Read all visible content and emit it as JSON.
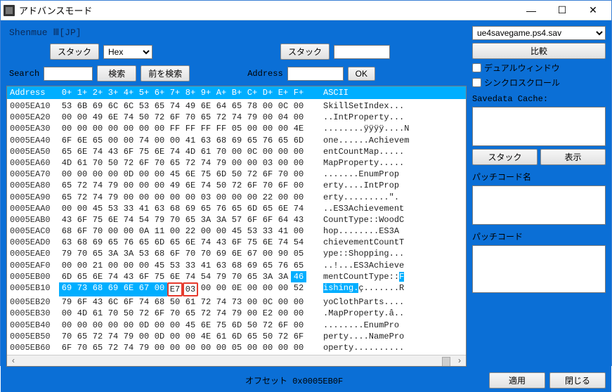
{
  "window": {
    "title": "アドバンスモード"
  },
  "winbtns": {
    "min": "—",
    "max": "☐",
    "close": "✕"
  },
  "file_title": "Shenmue Ⅲ[JP]",
  "toolbar1": {
    "stack": "スタック",
    "hex": "Hex",
    "search_label": "Search",
    "search_btn": "検索",
    "search_prev": "前を検索",
    "address_label": "Address",
    "stack2": "スタック",
    "ok": "OK"
  },
  "hexheader": {
    "address": "Address",
    "cols": [
      "0+",
      "1+",
      "2+",
      "3+",
      "4+",
      "5+",
      "6+",
      "7+",
      "8+",
      "9+",
      "A+",
      "B+",
      "C+",
      "D+",
      "E+",
      "F+"
    ],
    "ascii": "ASCII"
  },
  "rows": [
    {
      "addr": "0005EA10",
      "bytes": [
        "53",
        "6B",
        "69",
        "6C",
        "6C",
        "53",
        "65",
        "74",
        "49",
        "6E",
        "64",
        "65",
        "78",
        "00",
        "0C",
        "00"
      ],
      "ascii": "SkillSetIndex..."
    },
    {
      "addr": "0005EA20",
      "bytes": [
        "00",
        "00",
        "49",
        "6E",
        "74",
        "50",
        "72",
        "6F",
        "70",
        "65",
        "72",
        "74",
        "79",
        "00",
        "04",
        "00"
      ],
      "ascii": "..IntProperty..."
    },
    {
      "addr": "0005EA30",
      "bytes": [
        "00",
        "00",
        "00",
        "00",
        "00",
        "00",
        "00",
        "FF",
        "FF",
        "FF",
        "FF",
        "05",
        "00",
        "00",
        "00",
        "4E"
      ],
      "ascii": "........ÿÿÿÿ....N"
    },
    {
      "addr": "0005EA40",
      "bytes": [
        "6F",
        "6E",
        "65",
        "00",
        "00",
        "74",
        "00",
        "00",
        "41",
        "63",
        "68",
        "69",
        "65",
        "76",
        "65",
        "6D"
      ],
      "ascii": "one......Achievem"
    },
    {
      "addr": "0005EA50",
      "bytes": [
        "65",
        "6E",
        "74",
        "43",
        "6F",
        "75",
        "6E",
        "74",
        "4D",
        "61",
        "70",
        "00",
        "0C",
        "00",
        "00",
        "00"
      ],
      "ascii": "entCountMap....."
    },
    {
      "addr": "0005EA60",
      "bytes": [
        "4D",
        "61",
        "70",
        "50",
        "72",
        "6F",
        "70",
        "65",
        "72",
        "74",
        "79",
        "00",
        "00",
        "03",
        "00",
        "00"
      ],
      "ascii": "MapProperty....."
    },
    {
      "addr": "0005EA70",
      "bytes": [
        "00",
        "00",
        "00",
        "00",
        "0D",
        "00",
        "00",
        "45",
        "6E",
        "75",
        "6D",
        "50",
        "72",
        "6F",
        "70",
        "00"
      ],
      "ascii": ".......EnumProp"
    },
    {
      "addr": "0005EA80",
      "bytes": [
        "65",
        "72",
        "74",
        "79",
        "00",
        "00",
        "00",
        "49",
        "6E",
        "74",
        "50",
        "72",
        "6F",
        "70",
        "6F",
        "00"
      ],
      "ascii": "erty....IntProp"
    },
    {
      "addr": "0005EA90",
      "bytes": [
        "65",
        "72",
        "74",
        "79",
        "00",
        "00",
        "00",
        "00",
        "00",
        "03",
        "00",
        "00",
        "00",
        "22",
        "00",
        "00"
      ],
      "ascii": "erty.........\"."
    },
    {
      "addr": "0005EAA0",
      "bytes": [
        "00",
        "00",
        "45",
        "53",
        "33",
        "41",
        "63",
        "68",
        "69",
        "65",
        "76",
        "65",
        "6D",
        "65",
        "6E",
        "74"
      ],
      "ascii": "..ES3Achievement"
    },
    {
      "addr": "0005EAB0",
      "bytes": [
        "43",
        "6F",
        "75",
        "6E",
        "74",
        "54",
        "79",
        "70",
        "65",
        "3A",
        "3A",
        "57",
        "6F",
        "6F",
        "64",
        "43"
      ],
      "ascii": "CountType::WoodC"
    },
    {
      "addr": "0005EAC0",
      "bytes": [
        "68",
        "6F",
        "70",
        "00",
        "00",
        "0A",
        "11",
        "00",
        "22",
        "00",
        "00",
        "45",
        "53",
        "33",
        "41",
        "00"
      ],
      "ascii": "hop........ES3A"
    },
    {
      "addr": "0005EAD0",
      "bytes": [
        "63",
        "68",
        "69",
        "65",
        "76",
        "65",
        "6D",
        "65",
        "6E",
        "74",
        "43",
        "6F",
        "75",
        "6E",
        "74",
        "54"
      ],
      "ascii": "chievementCountT"
    },
    {
      "addr": "0005EAE0",
      "bytes": [
        "79",
        "70",
        "65",
        "3A",
        "3A",
        "53",
        "68",
        "6F",
        "70",
        "70",
        "69",
        "6E",
        "67",
        "00",
        "90",
        "05"
      ],
      "ascii": "ype::Shopping..."
    },
    {
      "addr": "0005EAF0",
      "bytes": [
        "00",
        "00",
        "21",
        "00",
        "00",
        "00",
        "45",
        "53",
        "33",
        "41",
        "63",
        "68",
        "69",
        "65",
        "76",
        "65"
      ],
      "ascii": "..!...ES3Achieve"
    },
    {
      "addr": "0005EB00",
      "bytes": [
        "6D",
        "65",
        "6E",
        "74",
        "43",
        "6F",
        "75",
        "6E",
        "74",
        "54",
        "79",
        "70",
        "65",
        "3A",
        "3A",
        "46"
      ],
      "ascii": "mentCountType::F"
    },
    {
      "addr": "0005EB10",
      "bytes": [
        "69",
        "73",
        "68",
        "69",
        "6E",
        "67",
        "00",
        "E7",
        "03",
        "00",
        "00",
        "0E",
        "00",
        "00",
        "00",
        "52"
      ],
      "ascii": "ishing.ç.......R"
    },
    {
      "addr": "0005EB20",
      "bytes": [
        "79",
        "6F",
        "43",
        "6C",
        "6F",
        "74",
        "68",
        "50",
        "61",
        "72",
        "74",
        "73",
        "00",
        "0C",
        "00",
        "00"
      ],
      "ascii": "yoClothParts...."
    },
    {
      "addr": "0005EB30",
      "bytes": [
        "00",
        "4D",
        "61",
        "70",
        "50",
        "72",
        "6F",
        "70",
        "65",
        "72",
        "74",
        "79",
        "00",
        "E2",
        "00",
        "00"
      ],
      "ascii": ".MapProperty.â.."
    },
    {
      "addr": "0005EB40",
      "bytes": [
        "00",
        "00",
        "00",
        "00",
        "00",
        "0D",
        "00",
        "00",
        "45",
        "6E",
        "75",
        "6D",
        "50",
        "72",
        "6F",
        "00"
      ],
      "ascii": "........EnumPro"
    },
    {
      "addr": "0005EB50",
      "bytes": [
        "70",
        "65",
        "72",
        "74",
        "79",
        "00",
        "0D",
        "00",
        "00",
        "4E",
        "61",
        "6D",
        "65",
        "50",
        "72",
        "6F"
      ],
      "ascii": "perty....NamePro"
    },
    {
      "addr": "0005EB60",
      "bytes": [
        "6F",
        "70",
        "65",
        "72",
        "74",
        "79",
        "00",
        "00",
        "00",
        "00",
        "00",
        "05",
        "00",
        "00",
        "00",
        "00"
      ],
      "ascii": "operty.........."
    }
  ],
  "highlight": {
    "row": 16,
    "startBytes": 0,
    "endBytes": 6,
    "asciiStart": 0,
    "asciiEnd": 6,
    "lastColPrevRow": true
  },
  "redbox": {
    "row": 16,
    "bytes": [
      7,
      8
    ]
  },
  "offset_text": "オフセット 0x0005EB0F",
  "right": {
    "combo": "ue4savegame.ps4.sav",
    "compare": "比較",
    "check_dual": "デュアルウィンドウ",
    "check_sync": "シンクロスクロール",
    "savedata_cache": "Savedata Cache:",
    "stack": "スタック",
    "show": "表示",
    "patchname": "パッチコード名",
    "patchcode": "パッチコード"
  },
  "footer": {
    "apply": "適用",
    "close": "閉じる"
  }
}
